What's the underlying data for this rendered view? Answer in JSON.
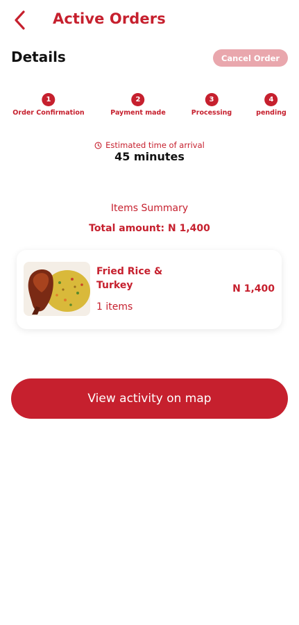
{
  "header": {
    "title": "Active Orders",
    "back_icon": "chevron-left-icon"
  },
  "details": {
    "heading": "Details",
    "cancel_label": "Cancel Order"
  },
  "steps": [
    {
      "number": "1",
      "label": "Order Confirmation"
    },
    {
      "number": "2",
      "label": "Payment made"
    },
    {
      "number": "3",
      "label": "Processing"
    },
    {
      "number": "4",
      "label": "pending"
    }
  ],
  "eta": {
    "icon": "clock-icon",
    "label": "Estimated time of arrival",
    "value": "45 minutes"
  },
  "summary": {
    "heading": "Items Summary",
    "total": "Total amount: N 1,400"
  },
  "items": [
    {
      "name": "Fried Rice & Turkey",
      "quantity": "1 items",
      "price": "N 1,400",
      "image": "fried-rice-turkey-photo"
    }
  ],
  "actions": {
    "map_label": "View activity on map"
  },
  "colors": {
    "accent": "#c6202e",
    "cancel_button": "#e9a7ad",
    "text_dark": "#111111",
    "background": "#ffffff"
  }
}
